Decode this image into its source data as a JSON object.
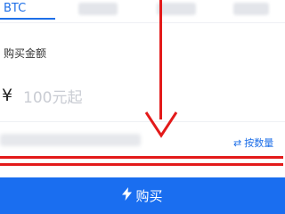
{
  "tabs": {
    "active_label": "BTC"
  },
  "form": {
    "amount_label": "购买金额",
    "currency_symbol": "¥",
    "amount_placeholder": "100元起",
    "amount_value": "",
    "switch_mode_label": "按数量",
    "switch_icon": "swap-arrows-icon"
  },
  "actions": {
    "buy_label": "购买",
    "buy_icon": "lightning-bolt-icon"
  },
  "colors": {
    "accent": "#1e6fe8",
    "buy_button": "#1a6ef0",
    "annotation_red": "#e31a1a"
  }
}
